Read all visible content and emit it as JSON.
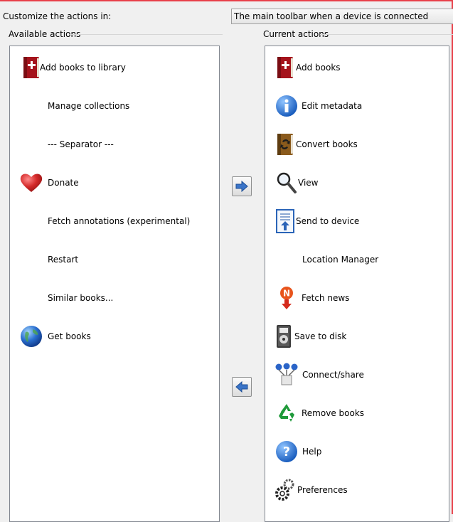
{
  "customize_label": "Customize the actions in:",
  "combo_value": "The main toolbar when a device is connected",
  "available_label": "Available actions",
  "current_label": "Current actions",
  "available_actions": [
    {
      "label": "Add books to library",
      "icon": "add-book-icon"
    },
    {
      "label": "Manage collections",
      "icon": ""
    },
    {
      "label": "--- Separator ---",
      "icon": ""
    },
    {
      "label": "Donate",
      "icon": "heart-icon"
    },
    {
      "label": "Fetch annotations (experimental)",
      "icon": ""
    },
    {
      "label": "Restart",
      "icon": ""
    },
    {
      "label": "Similar books...",
      "icon": ""
    },
    {
      "label": "Get books",
      "icon": "globe-icon"
    }
  ],
  "current_actions": [
    {
      "label": "Add books",
      "icon": "add-book-icon"
    },
    {
      "label": "Edit metadata",
      "icon": "info-icon"
    },
    {
      "label": "Convert books",
      "icon": "convert-icon"
    },
    {
      "label": "View",
      "icon": "magnifier-icon"
    },
    {
      "label": "Send to device",
      "icon": "send-device-icon"
    },
    {
      "label": "Location Manager",
      "icon": ""
    },
    {
      "label": "Fetch news",
      "icon": "news-icon"
    },
    {
      "label": "Save to disk",
      "icon": "save-disk-icon"
    },
    {
      "label": "Connect/share",
      "icon": "network-icon"
    },
    {
      "label": "Remove books",
      "icon": "recycle-icon"
    },
    {
      "label": "Help",
      "icon": "help-icon"
    },
    {
      "label": "Preferences",
      "icon": "gear-icon"
    }
  ],
  "buttons": {
    "add_to_current": "arrow-right-icon",
    "remove_from_current": "arrow-left-icon"
  }
}
